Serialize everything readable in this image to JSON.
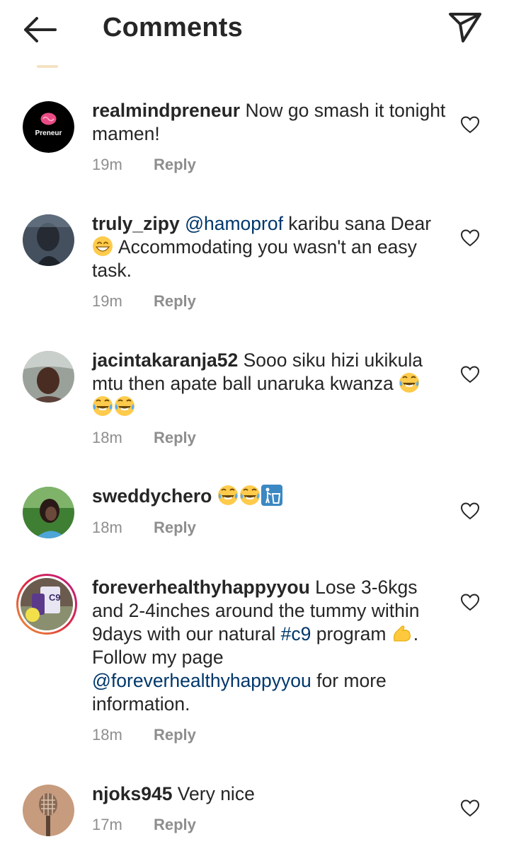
{
  "header": {
    "title": "Comments",
    "back_icon": "arrow-left-icon",
    "share_icon": "paper-plane-icon"
  },
  "comments": [
    {
      "username": "realmindpreneur",
      "text": " Now go smash it tonight mamen!",
      "time": "19m",
      "reply": "Reply",
      "avatar_text": "Preneur"
    },
    {
      "username": "truly_zipy",
      "mention": "@hamoprof",
      "text_a": "  karibu sana Dear ",
      "text_b": " Accommodating you wasn't an easy task.",
      "emoji": "grinning-face",
      "time": "19m",
      "reply": "Reply"
    },
    {
      "username": "jacintakaranja52",
      "text": " Sooo siku hizi ukikula mtu then apate ball unaruka kwanza ",
      "emoji": "tears-of-joy-x3",
      "time": "18m",
      "reply": "Reply"
    },
    {
      "username": "sweddychero",
      "emoji": "tears-of-joy-x2-litter-bin",
      "time": "18m",
      "reply": "Reply"
    },
    {
      "username": "foreverhealthyhappyyou",
      "text_a": " Lose 3-6kgs and 2-4inches around the tummy within 9days with our natural ",
      "hashtag": "#c9",
      "text_b": " program ",
      "text_c": ". Follow my page ",
      "mention": "@foreverhealthyhappyyou",
      "text_d": " for more information.",
      "emoji": "flexed-biceps",
      "time": "18m",
      "reply": "Reply",
      "avatar_label": "C9"
    },
    {
      "username": "njoks945",
      "text": " Very nice",
      "time": "17m",
      "reply": "Reply"
    }
  ],
  "colors": {
    "text": "#262626",
    "secondary": "#8e8e8e",
    "link": "#00376b",
    "story_ring_start": "#f09433",
    "story_ring_end": "#bc1888"
  },
  "icons": {
    "like": "heart-outline-icon"
  }
}
